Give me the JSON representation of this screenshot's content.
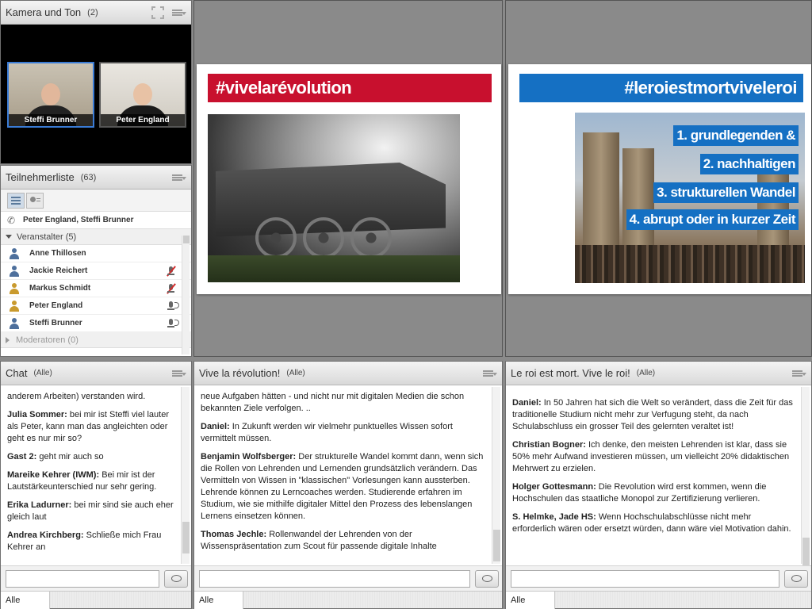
{
  "camera": {
    "title": "Kamera und Ton",
    "count": "(2)",
    "videos": [
      {
        "name": "Steffi Brunner"
      },
      {
        "name": "Peter England"
      }
    ]
  },
  "participants": {
    "title": "Teilnehmerliste",
    "count": "(63)",
    "speaking": "Peter England, Steffi Brunner",
    "hosts_group": "Veranstalter (5)",
    "hosts": [
      {
        "name": "Anne Thillosen",
        "mic": "none"
      },
      {
        "name": "Jackie Reichert",
        "mic": "muted"
      },
      {
        "name": "Markus Schmidt",
        "mic": "muted"
      },
      {
        "name": "Peter England",
        "mic": "active"
      },
      {
        "name": "Steffi Brunner",
        "mic": "active"
      }
    ],
    "presenters_group": "Moderatoren (0)"
  },
  "slides": {
    "left": {
      "banner": "#vivelarévolution"
    },
    "right": {
      "banner": "#leroiestmortviveleroi",
      "points": [
        "1. grundlegenden &",
        "2. nachhaltigen",
        "3. strukturellen Wandel",
        "4. abrupt oder in kurzer Zeit"
      ]
    }
  },
  "chats": [
    {
      "title": "Chat",
      "scope": "(Alle)",
      "tab": "Alle",
      "messages": [
        {
          "author": "",
          "text": "anderem Arbeiten) verstanden wird."
        },
        {
          "author": "Julia Sommer:",
          "text": " bei mir ist Steffi viel lauter als Peter, kann man das angleichten oder geht es nur mir so?"
        },
        {
          "author": "Gast 2:",
          "text": " geht mir auch so"
        },
        {
          "author": "Mareike Kehrer (IWM):",
          "text": " Bei mir ist der Lautstärkeunterschied nur sehr gering."
        },
        {
          "author": "Erika Ladurner:",
          "text": " bei mir sind sie auch eher gleich laut"
        },
        {
          "author": "Andrea Kirchberg:",
          "text": " Schließe mich Frau Kehrer an"
        }
      ]
    },
    {
      "title": "Vive la révolution!",
      "scope": "(Alle)",
      "tab": "Alle",
      "messages": [
        {
          "author": "",
          "text": "neue Aufgaben hätten - und nicht nur mit digitalen Medien die schon bekannten Ziele verfolgen. .."
        },
        {
          "author": "Daniel:",
          "text": " In Zukunft werden wir vielmehr punktuelles Wissen sofort vermittelt müssen."
        },
        {
          "author": "Benjamin Wolfsberger:",
          "text": " Der strukturelle Wandel kommt dann, wenn sich die Rollen von Lehrenden und Lernenden grundsätzlich verändern. Das Vermitteln von Wissen in \"klassischen\" Vorlesungen kann aussterben. Lehrende können zu Lerncoaches werden. Studierende erfahren im Studium, wie sie mithilfe digitaler Mittel  den Prozess des lebenslangen Lernens einsetzen können."
        },
        {
          "author": "Thomas Jechle:",
          "text": " Rollenwandel der Lehrenden von der Wissenspräsentation zum Scout für passende digitale Inhalte"
        }
      ]
    },
    {
      "title": "Le roi est mort. Vive le roi!",
      "scope": "(Alle)",
      "tab": "Alle",
      "messages": [
        {
          "author": "Daniel:",
          "text": " In 50 Jahren hat sich die Welt so verändert, dass die Zeit für das traditionelle Studium nicht mehr zur Verfugung steht, da nach Schulabschluss ein grosser Teil des gelernten veraltet ist!"
        },
        {
          "author": "Christian Bogner:",
          "text": " Ich denke, den meisten Lehrenden ist klar, dass sie 50% mehr Aufwand investieren müssen, um vielleicht 20% didaktischen Mehrwert zu erzielen."
        },
        {
          "author": "Holger Gottesmann:",
          "text": " Die Revolution wird erst kommen, wenn die Hochschulen das staatliche Monopol zur Zertifizierung verlieren."
        },
        {
          "author": "S. Helmke, Jade HS:",
          "text": " Wenn Hochschulabschlüsse nicht mehr erforderlich wären oder ersetzt würden, dann wäre viel Motivation dahin."
        }
      ]
    }
  ]
}
